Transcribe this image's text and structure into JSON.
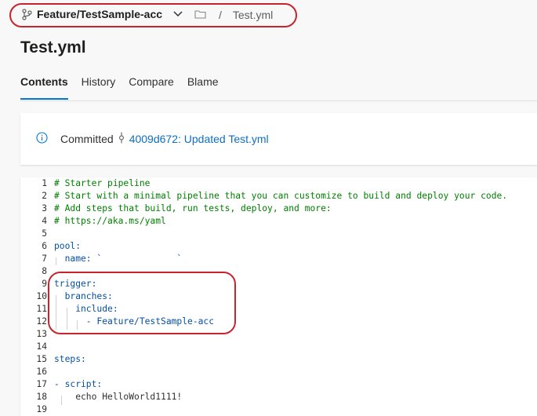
{
  "header": {
    "branch_name": "Feature/TestSample-acc",
    "breadcrumb_sep": "/",
    "file_name": "Test.yml"
  },
  "page_title": "Test.yml",
  "tabs": [
    {
      "label": "Contents",
      "active": true
    },
    {
      "label": "History",
      "active": false
    },
    {
      "label": "Compare",
      "active": false
    },
    {
      "label": "Blame",
      "active": false
    }
  ],
  "commit": {
    "label": "Committed",
    "link_text": "4009d672: Updated Test.yml"
  },
  "code_lines": [
    {
      "n": "1",
      "text": "# Starter pipeline"
    },
    {
      "n": "2",
      "text": "# Start with a minimal pipeline that you can customize to build and deploy your code."
    },
    {
      "n": "3",
      "text": "# Add steps that build, run tests, deploy, and more:"
    },
    {
      "n": "4",
      "text": "# https://aka.ms/yaml"
    },
    {
      "n": "5",
      "text": ""
    },
    {
      "n": "6",
      "text": "pool:"
    },
    {
      "n": "7",
      "text": "  name: `              `"
    },
    {
      "n": "8",
      "text": ""
    },
    {
      "n": "9",
      "text": "trigger:"
    },
    {
      "n": "10",
      "text": "  branches:"
    },
    {
      "n": "11",
      "text": "    include:"
    },
    {
      "n": "12",
      "text": "      - Feature/TestSample-acc"
    },
    {
      "n": "13",
      "text": ""
    },
    {
      "n": "14",
      "text": ""
    },
    {
      "n": "15",
      "text": "steps:"
    },
    {
      "n": "16",
      "text": ""
    },
    {
      "n": "17",
      "text": "- script:"
    },
    {
      "n": "18",
      "text": "    echo HelloWorld1111!"
    },
    {
      "n": "19",
      "text": ""
    }
  ],
  "colors": {
    "accent": "#0078d4",
    "link": "#106ebe",
    "highlight_box": "#c8242d",
    "comment": "#008000",
    "yaml_key": "#0451a5"
  }
}
